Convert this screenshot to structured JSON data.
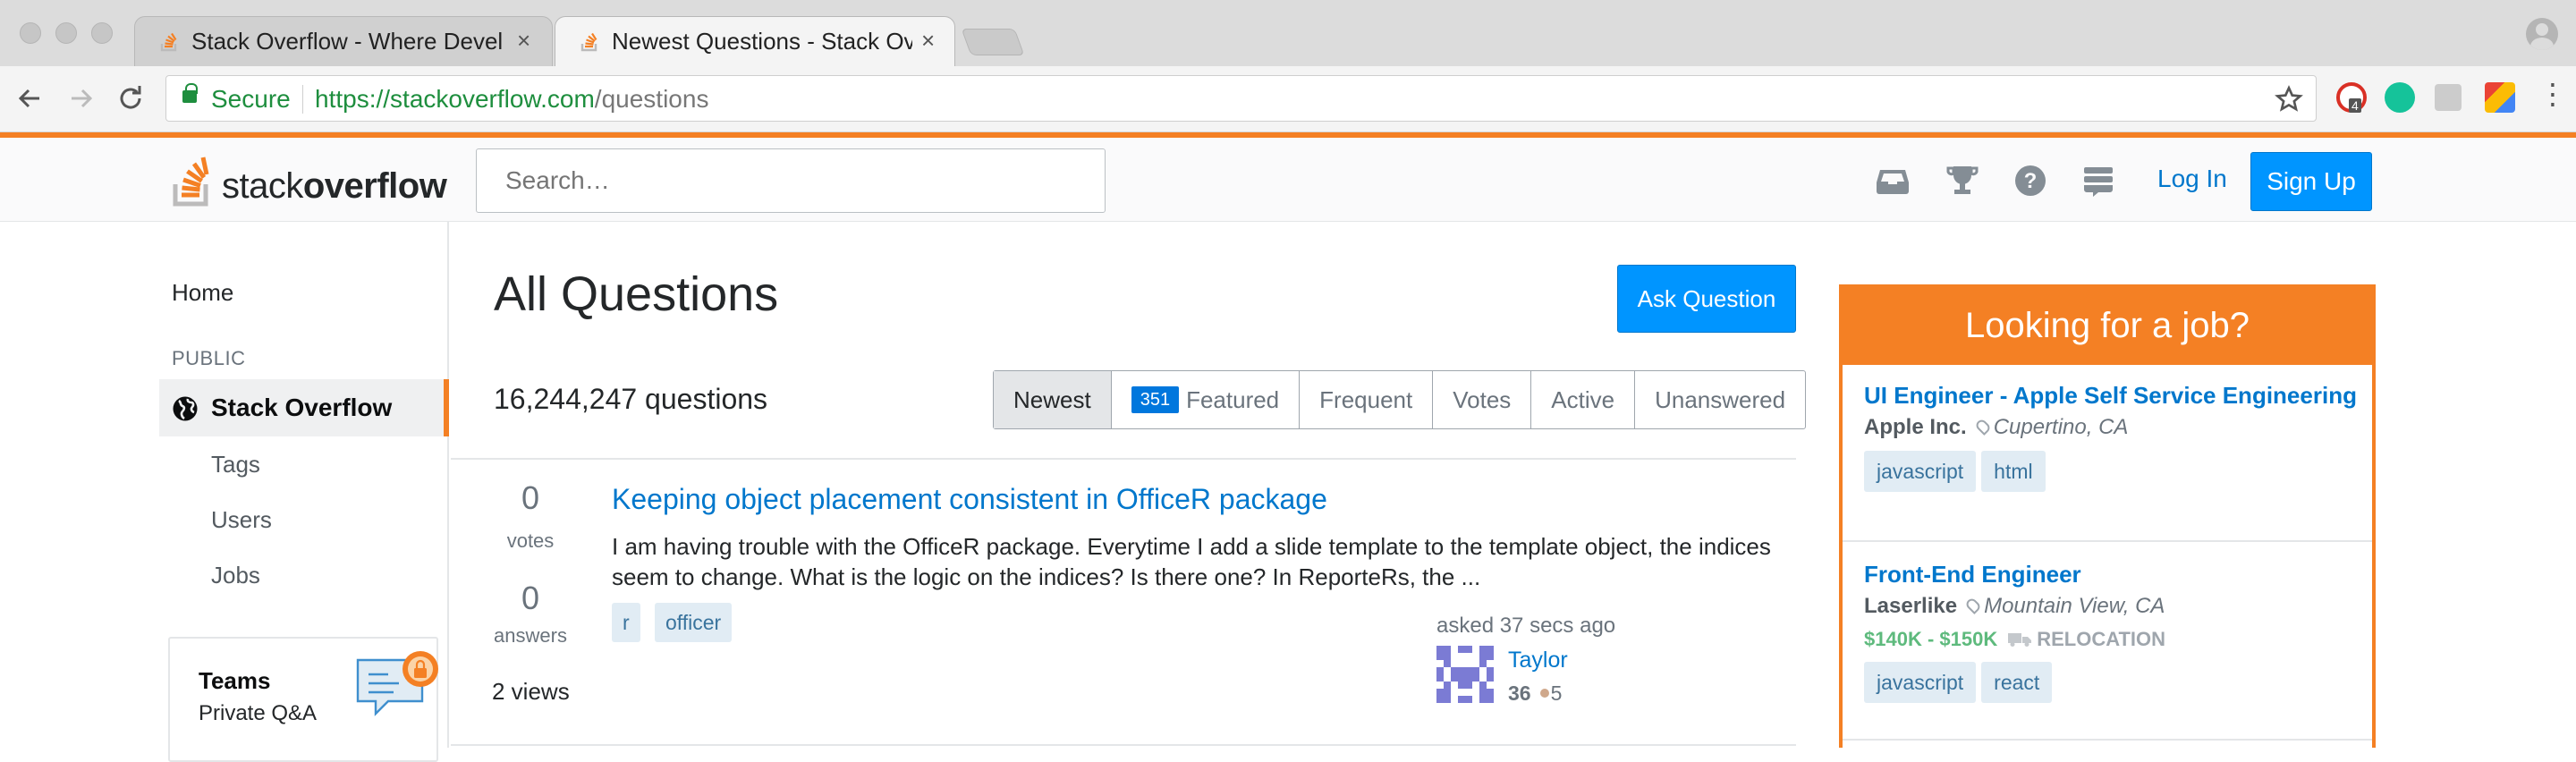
{
  "browser": {
    "tabs": [
      {
        "title": "Stack Overflow - Where Devel"
      },
      {
        "title": "Newest Questions - Stack Ove"
      }
    ],
    "close_glyph": "×",
    "secure_label": "Secure",
    "url_host": "https://stackoverflow.com",
    "url_path": "/questions",
    "extension_badge": "4",
    "icons": [
      "back-arrow-icon",
      "forward-arrow-icon",
      "reload-icon",
      "lock-icon",
      "star-icon",
      "menu-icon"
    ]
  },
  "header": {
    "logo_light": "stack",
    "logo_bold": "overflow",
    "search_placeholder": "Search…",
    "login_label": "Log In",
    "signup_label": "Sign Up",
    "icons": [
      "inbox-icon",
      "trophy-icon",
      "help-icon",
      "site-switcher-icon"
    ]
  },
  "sidebar": {
    "home": "Home",
    "public_label": "PUBLIC",
    "stack_overflow": "Stack Overflow",
    "items": [
      "Tags",
      "Users",
      "Jobs"
    ],
    "teams_title": "Teams",
    "teams_subtitle": "Private Q&A"
  },
  "main": {
    "title": "All Questions",
    "ask_button": "Ask Question",
    "question_count": "16,244,247 questions",
    "filters": {
      "newest": "Newest",
      "featured_badge": "351",
      "featured": "Featured",
      "frequent": "Frequent",
      "votes": "Votes",
      "active": "Active",
      "unanswered": "Unanswered"
    },
    "question": {
      "votes": "0",
      "votes_label": "votes",
      "answers": "0",
      "answers_label": "answers",
      "views": "2 views",
      "title": "Keeping object placement consistent in OfficeR package",
      "excerpt": "I am having trouble with the OfficeR package. Everytime I add a slide template to the template object, the indices seem to change. What is the logic on the indices? Is there one? In ReporteRs, the ...",
      "tags": [
        "r",
        "officer"
      ],
      "asked": "asked 37 secs ago",
      "user": "Taylor",
      "reputation": "36",
      "bronze": "5"
    }
  },
  "jobs": {
    "heading": "Looking for a job?",
    "listings": [
      {
        "title": "UI Engineer - Apple Self Service Engineering",
        "company": "Apple Inc.",
        "location": "Cupertino, CA",
        "tags": [
          "javascript",
          "html"
        ]
      },
      {
        "title": "Front-End Engineer",
        "company": "Laserlike",
        "location": "Mountain View, CA",
        "salary": "$140K - $150K",
        "relocation": "RELOCATION",
        "tags": [
          "javascript",
          "react"
        ]
      }
    ]
  },
  "colors": {
    "brand_orange": "#f48024",
    "link_blue": "#0077cc",
    "button_blue": "#0095ff",
    "tag_bg": "#e1ecf4",
    "tag_text": "#39739d",
    "salary_green": "#5eba7d"
  }
}
